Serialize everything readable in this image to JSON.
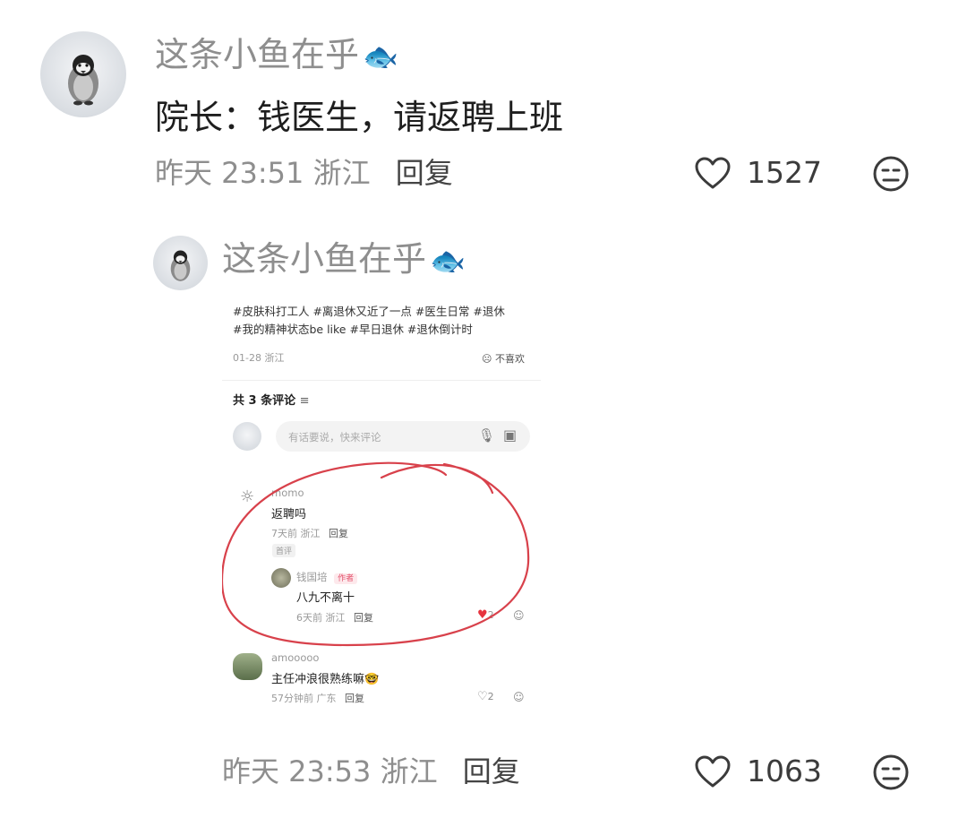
{
  "comment1": {
    "username": "这条小鱼在乎",
    "username_emoji": "🐟",
    "text": "院长：钱医生，请返聘上班",
    "time": "昨天 23:51",
    "location": "浙江",
    "reply_label": "回复",
    "likes": "1527"
  },
  "comment2": {
    "username": "这条小鱼在乎",
    "username_emoji": "🐟",
    "time": "昨天 23:53",
    "location": "浙江",
    "reply_label": "回复",
    "likes": "1063"
  },
  "screenshot": {
    "hashtags_line1": "#皮肤科打工人 #离退休又近了一点 #医生日常 #退休",
    "hashtags_line2": "#我的精神状态be like #早日退休 #退休倒计时",
    "post_date": "01-28 浙江",
    "dislike_label": "不喜欢",
    "comment_count_label": "共 3 条评论",
    "input_placeholder": "有话要说，快来评论",
    "comments": [
      {
        "username": "momo",
        "text": "返聘吗",
        "meta": "7天前 浙江",
        "reply_label": "回复",
        "badge": "首评"
      },
      {
        "username": "钱国培",
        "author_badge": "作者",
        "text": "八九不离十",
        "meta": "6天前 浙江",
        "reply_label": "回复",
        "likes": "2"
      },
      {
        "username": "amooooo",
        "text": "主任冲浪很熟练嘛",
        "text_emoji": "🤓",
        "meta": "57分钟前 广东",
        "reply_label": "回复",
        "likes": "2"
      }
    ]
  },
  "colors": {
    "accent_red": "#d8414b",
    "heart_red": "#e6343f",
    "username_gray": "#8e8e8e"
  }
}
